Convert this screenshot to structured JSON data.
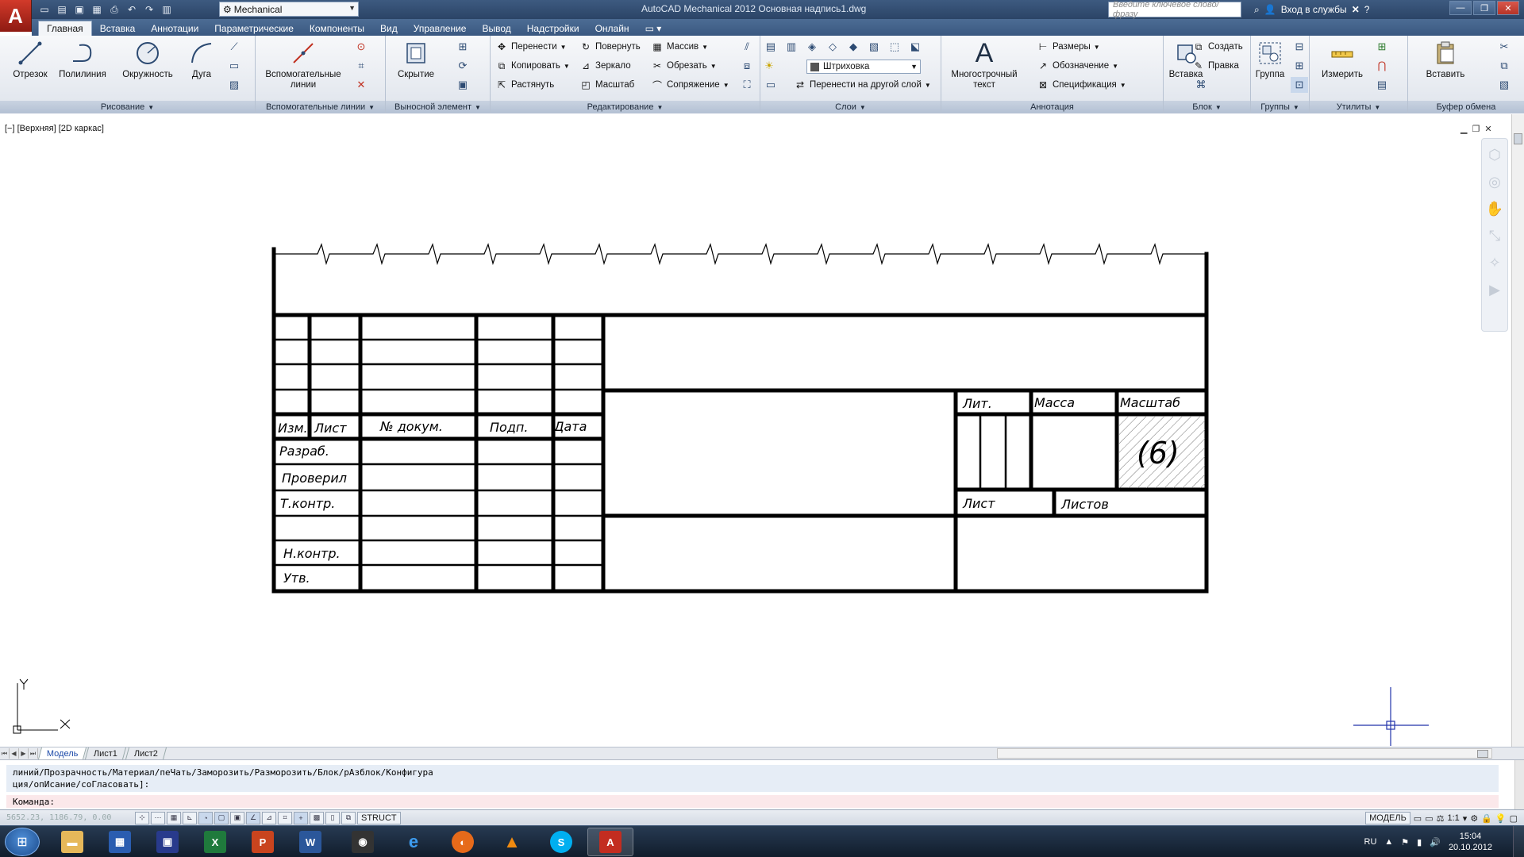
{
  "app": {
    "menu_letter": "A",
    "title": "AutoCAD Mechanical 2012    Основная надпись1.dwg",
    "workspace": "Mechanical",
    "search_placeholder": "Введите ключевое слово/фразу",
    "sign_in": "Вход в службы"
  },
  "ribbon_tabs": [
    "Главная",
    "Вставка",
    "Аннотации",
    "Параметрические",
    "Компоненты",
    "Вид",
    "Управление",
    "Вывод",
    "Надстройки",
    "Онлайн"
  ],
  "panels": {
    "draw": {
      "title": "Рисование",
      "line": "Отрезок",
      "polyline": "Полилиния",
      "circle": "Окружность",
      "arc": "Дуга"
    },
    "construction": {
      "title": "Вспомогательные линии",
      "button": "Вспомогательные линии"
    },
    "detail": {
      "title": "Выносной элемент",
      "button": "Скрытие"
    },
    "modify": {
      "title": "Редактирование",
      "move": "Перенести",
      "rotate": "Повернуть",
      "array": "Массив",
      "copy": "Копировать",
      "mirror": "Зеркало",
      "trim": "Обрезать",
      "stretch": "Растянуть",
      "scale": "Масштаб",
      "fillet": "Сопряжение"
    },
    "layers": {
      "title": "Слои",
      "current_layer": "Штриховка",
      "move_to_layer": "Перенести на другой слой"
    },
    "annotation": {
      "title": "Аннотация",
      "mtext": "Многострочный текст",
      "dimensions": "Размеры",
      "notation": "Обозначение",
      "parts_list": "Спецификация"
    },
    "block": {
      "title": "Блок",
      "insert": "Вставка",
      "create": "Создать",
      "edit": "Правка"
    },
    "groups": {
      "title": "Группы",
      "group": "Группа"
    },
    "utilities": {
      "title": "Утилиты",
      "measure": "Измерить"
    },
    "clipboard": {
      "title": "Буфер обмена",
      "paste": "Вставить"
    }
  },
  "viewport": {
    "label": "[−] [Верхняя] [2D каркас]",
    "axis_x": "X",
    "axis_y": "Y"
  },
  "title_block": {
    "izm": "Изм.",
    "list": "Лист",
    "doc_no": "№ докум.",
    "sign": "Подп.",
    "date": "Дата",
    "developed": "Разраб.",
    "checked": "Проверил",
    "tech_control": "Т.контр.",
    "norm_control": "Н.контр.",
    "approved": "Утв.",
    "lit": "Лит.",
    "mass": "Масса",
    "scale": "Масштаб",
    "scale_field": "(6)",
    "sheet": "Лист",
    "sheets": "Листов"
  },
  "layout_tabs": [
    "Модель",
    "Лист1",
    "Лист2"
  ],
  "command_line": {
    "history_1": "линий/Прозрачность/Материал/пеЧать/Заморозить/Разморозить/Блок/рАзблок/Конфигура",
    "history_2": "ция/опИсание/соГласовать]:",
    "prompt": "Команда:"
  },
  "status_bar": {
    "coords": "5652.23, 1186.79, 0.00",
    "struct": "STRUCT",
    "model": "МОДЕЛЬ",
    "annotation_scale": "1:1"
  },
  "taskbar": {
    "language": "RU",
    "time": "15:04",
    "date": "20.10.2012"
  }
}
